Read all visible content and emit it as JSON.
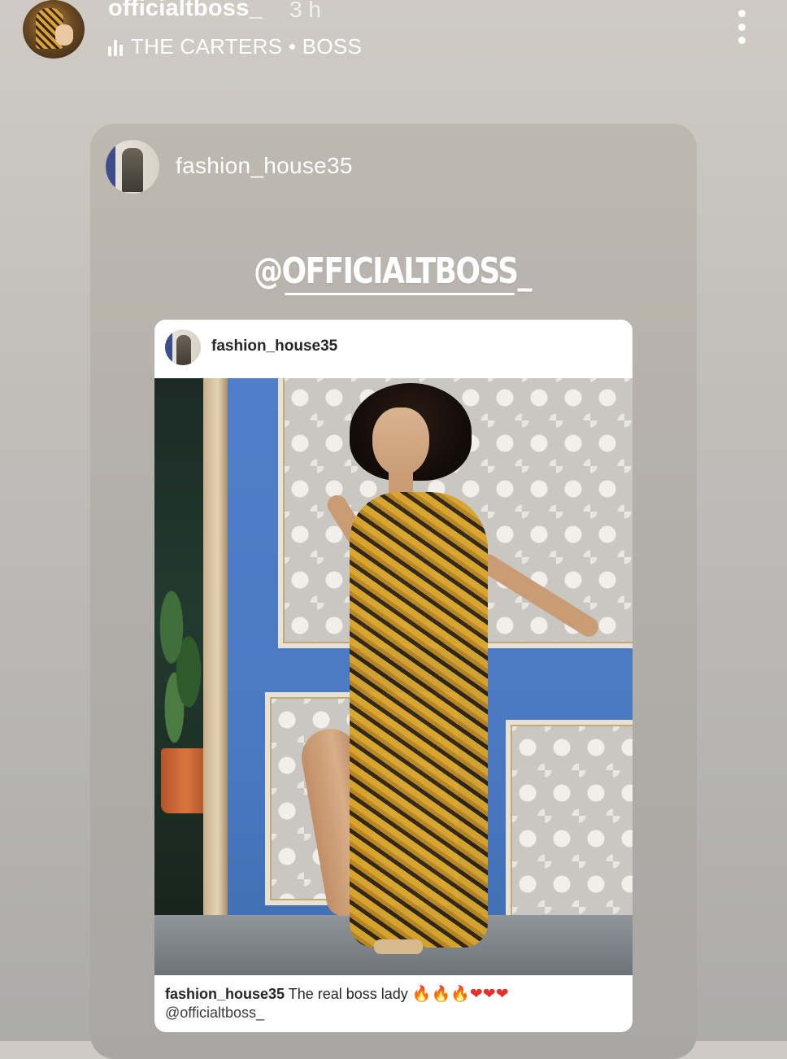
{
  "story": {
    "username": "officialtboss_",
    "time": "3 h",
    "music": "THE CARTERS • BOSS"
  },
  "shared_post": {
    "author": "fashion_house35",
    "mention_sticker": "@OFFICIALTBOSS_",
    "post": {
      "username": "fashion_house35",
      "caption_user": "fashion_house35",
      "caption_text": "The real boss lady",
      "caption_emojis": {
        "fire": "🔥",
        "heart": "❤"
      },
      "caption_mention": "@officialtboss_"
    }
  },
  "icons": {
    "more": "more-vertical-icon",
    "music": "music-bars-icon"
  },
  "colors": {
    "text_primary": "#ffffff",
    "caption_text": "#262626",
    "fire": "#f28b1e",
    "heart": "#e0332e"
  }
}
